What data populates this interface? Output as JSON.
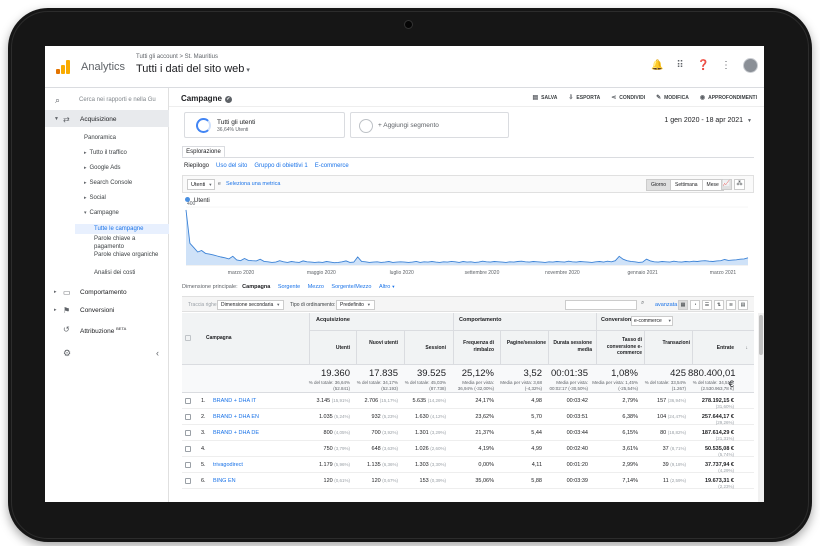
{
  "app": {
    "name": "Analytics"
  },
  "header": {
    "breadcrumb": "Tutti gli account > St. Mauritius",
    "view_title": "Tutti i dati del sito web",
    "icons": [
      "bell-icon",
      "apps-grid-icon",
      "help-icon",
      "more-vert-icon"
    ]
  },
  "sidebar": {
    "search_placeholder": "Cerca nei rapporti e nella Gu",
    "acquisition_label": "Acquisizione",
    "overview": "Panoramica",
    "sub_items": [
      "Tutto il traffico",
      "Google Ads",
      "Search Console",
      "Social"
    ],
    "campaigns_label": "Campagne",
    "campaign_items": [
      "Tutte le campagne",
      "Parole chiave a pagamento",
      "Parole chiave organiche",
      "Analisi dei costi"
    ],
    "behavior_label": "Comportamento",
    "conversions_label": "Conversioni",
    "attribution_label": "Attribuzione",
    "attribution_badge": "BETA"
  },
  "report": {
    "title": "Campagne",
    "actions": [
      "SALVA",
      "ESPORTA",
      "CONDIVIDI",
      "MODIFICA",
      "APPROFONDIMENTI"
    ],
    "segment_all": "Tutti gli utenti",
    "segment_all_sub": "36,64% Utenti",
    "segment_add": "+ Aggiungi segmento",
    "date_range": "1 gen 2020 - 18 apr 2021",
    "tab_explore": "Esplorazione",
    "subtabs": [
      "Riepilogo",
      "Uso del sito",
      "Gruppo di obiettivi 1",
      "E-commerce"
    ],
    "metric_select": "Utenti",
    "vs": "e",
    "select_metric": "Seleziona una metrica",
    "granularity": [
      "Giorno",
      "Settimana",
      "Mese"
    ]
  },
  "chart_data": {
    "type": "line",
    "series": [
      {
        "name": "Utenti",
        "values": [
          380,
          150,
          120,
          90,
          100,
          80,
          75,
          70,
          62,
          55,
          50,
          42,
          60,
          35,
          30,
          45,
          32,
          30,
          28,
          40,
          25,
          22,
          18,
          20,
          30,
          22,
          18,
          24,
          20,
          18,
          28,
          22,
          20,
          18,
          20,
          18,
          24,
          20,
          16,
          18,
          22,
          28,
          18,
          20,
          55,
          25,
          22,
          18,
          20,
          22,
          18,
          20,
          24,
          18,
          20,
          22,
          20,
          18,
          20,
          25,
          18,
          22,
          20,
          24,
          20,
          18,
          22,
          20,
          25,
          22,
          18,
          24,
          20,
          22,
          18,
          20,
          26,
          22,
          20,
          24,
          22,
          20,
          18,
          22,
          20,
          24,
          26,
          22,
          20,
          24,
          22,
          20,
          18,
          22,
          20,
          24,
          22,
          20,
          26,
          22,
          20,
          24,
          22,
          20,
          18,
          22,
          24,
          20,
          26,
          22,
          30,
          60,
          40,
          30,
          25,
          22,
          18,
          20,
          40,
          28,
          22,
          20,
          24,
          22,
          20,
          26,
          22,
          20,
          24,
          22,
          26,
          24,
          28,
          30,
          26,
          24,
          28,
          30,
          38,
          32,
          34,
          36,
          40,
          42,
          50
        ]
      }
    ],
    "ylim": [
      0,
      400
    ],
    "y_ticks": [
      400
    ],
    "x_tick_labels": [
      "marzo 2020",
      "maggio 2020",
      "luglio 2020",
      "settembre 2020",
      "novembre 2020",
      "gennaio 2021",
      "marzo 2021"
    ]
  },
  "dimensions": {
    "label": "Dimensione principale:",
    "current": "Campagna",
    "options": [
      "Sorgente",
      "Mezzo",
      "Sorgente/Mezzo",
      "Altro"
    ]
  },
  "toolbar": {
    "plot_rows": "Traccia righe",
    "secondary_dim": "Dimensione secondaria",
    "sort_label": "Tipo di ordinamento:",
    "sort_value": "Predefinito",
    "advanced": "avanzata"
  },
  "table": {
    "group_headers": [
      "Acquisizione",
      "Comportamento",
      "Conversioni"
    ],
    "conv_select": "e-commerce",
    "col_campaign": "Campagna",
    "columns": [
      "Utenti",
      "Nuovi utenti",
      "Sessioni",
      "Frequenza di rimbalzo",
      "Pagine/sessione",
      "Durata sessione media",
      "Tasso di conversione e-commerce",
      "Transazioni",
      "Entrate"
    ],
    "totals": [
      {
        "v": "19.360",
        "p": "% del totale: 36,64% (52.841)"
      },
      {
        "v": "17.835",
        "p": "% del totale: 34,17% (52.193)"
      },
      {
        "v": "39.525",
        "p": "% del totale: 45,03% (87.738)"
      },
      {
        "v": "25,12%",
        "p": "Media per vista: 36,94% (-32,00%)"
      },
      {
        "v": "3,52",
        "p": "Media per vista: 3,68 (-4,32%)"
      },
      {
        "v": "00:01:35",
        "p": "Media per vista: 00:02:17 (-30,50%)"
      },
      {
        "v": "1,08%",
        "p": "Media per vista: 1,45% (-25,54%)"
      },
      {
        "v": "425",
        "p": "% del totale: 33,54% (1.267)"
      },
      {
        "v": "880.400,01 €",
        "p": "% del totale: 34,51% (2.530.963,78 €)"
      }
    ],
    "rows": [
      {
        "n": "1.",
        "name": "BRAND + DHA IT",
        "cells": [
          [
            "3.145",
            "(15,91%)"
          ],
          [
            "2.706",
            "(15,17%)"
          ],
          [
            "5.635",
            "(14,26%)"
          ],
          [
            "24,17%",
            ""
          ],
          [
            "4,98",
            ""
          ],
          [
            "00:03:42",
            ""
          ],
          [
            "2,79%",
            ""
          ],
          [
            "157",
            "(36,94%)"
          ],
          [
            "278.192,15 €",
            "(31,60%)"
          ]
        ]
      },
      {
        "n": "2.",
        "name": "BRAND + DHA EN",
        "cells": [
          [
            "1.035",
            "(5,24%)"
          ],
          [
            "932",
            "(5,23%)"
          ],
          [
            "1.630",
            "(4,12%)"
          ],
          [
            "23,62%",
            ""
          ],
          [
            "5,70",
            ""
          ],
          [
            "00:03:51",
            ""
          ],
          [
            "6,38%",
            ""
          ],
          [
            "104",
            "(24,47%)"
          ],
          [
            "257.644,17 €",
            "(29,26%)"
          ]
        ]
      },
      {
        "n": "3.",
        "name": "BRAND + DHA DE",
        "cells": [
          [
            "800",
            "(4,05%)"
          ],
          [
            "700",
            "(3,92%)"
          ],
          [
            "1.301",
            "(3,29%)"
          ],
          [
            "21,37%",
            ""
          ],
          [
            "5,44",
            ""
          ],
          [
            "00:03:44",
            ""
          ],
          [
            "6,15%",
            ""
          ],
          [
            "80",
            "(18,82%)"
          ],
          [
            "187.614,29 €",
            "(21,31%)"
          ]
        ]
      },
      {
        "n": "4.",
        "name": "",
        "cells": [
          [
            "750",
            "(3,79%)"
          ],
          [
            "648",
            "(3,63%)"
          ],
          [
            "1.026",
            "(2,60%)"
          ],
          [
            "4,19%",
            ""
          ],
          [
            "4,99",
            ""
          ],
          [
            "00:02:40",
            ""
          ],
          [
            "3,61%",
            ""
          ],
          [
            "37",
            "(8,71%)"
          ],
          [
            "50.535,08 €",
            "(5,74%)"
          ]
        ]
      },
      {
        "n": "5.",
        "name": "trivagodirect",
        "cells": [
          [
            "1.179",
            "(5,96%)"
          ],
          [
            "1.135",
            "(6,36%)"
          ],
          [
            "1.303",
            "(3,30%)"
          ],
          [
            "0,00%",
            ""
          ],
          [
            "4,11",
            ""
          ],
          [
            "00:01:20",
            ""
          ],
          [
            "2,99%",
            ""
          ],
          [
            "39",
            "(9,18%)"
          ],
          [
            "37.737,94 €",
            "(4,29%)"
          ]
        ]
      },
      {
        "n": "6.",
        "name": "BING EN",
        "cells": [
          [
            "120",
            "(0,61%)"
          ],
          [
            "120",
            "(0,67%)"
          ],
          [
            "153",
            "(0,39%)"
          ],
          [
            "35,06%",
            ""
          ],
          [
            "5,88",
            ""
          ],
          [
            "00:03:39",
            ""
          ],
          [
            "7,14%",
            ""
          ],
          [
            "11",
            "(2,59%)"
          ],
          [
            "19.673,31 €",
            "(2,23%)"
          ]
        ]
      }
    ]
  }
}
